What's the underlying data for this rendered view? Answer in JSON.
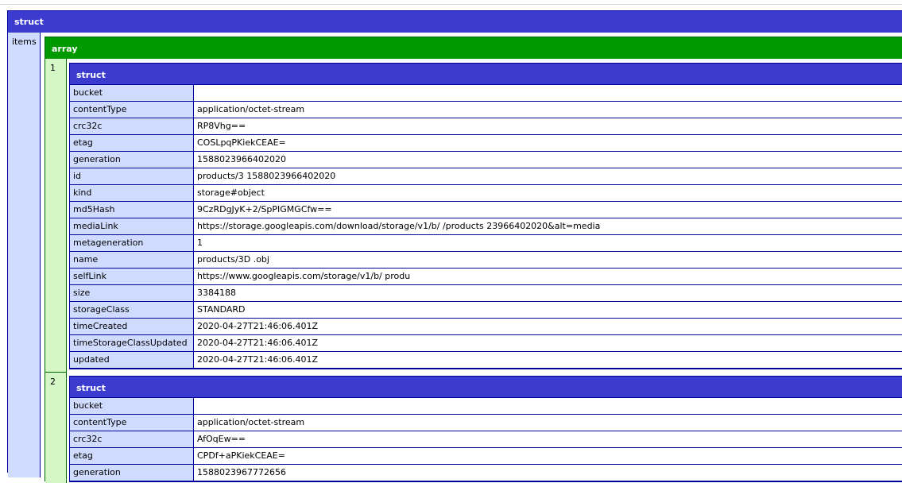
{
  "outer": {
    "title": "struct",
    "items_label": "items"
  },
  "array": {
    "title": "array"
  },
  "records": [
    {
      "index": "1",
      "title": "struct",
      "fields": [
        {
          "key": "bucket",
          "value": ""
        },
        {
          "key": "contentType",
          "value": "application/octet-stream"
        },
        {
          "key": "crc32c",
          "value": "RP8Vhg=="
        },
        {
          "key": "etag",
          "value": "COSLpqPKiekCEAE="
        },
        {
          "key": "generation",
          "value": "1588023966402020"
        },
        {
          "key": "id",
          "value": "products/3                                  1588023966402020"
        },
        {
          "key": "kind",
          "value": "storage#object"
        },
        {
          "key": "md5Hash",
          "value": "9CzRDgJyK+2/SpPIGMGCfw=="
        },
        {
          "key": "mediaLink",
          "value": "https://storage.googleapis.com/download/storage/v1/b/                  /products                                                           23966402020&alt=media"
        },
        {
          "key": "metageneration",
          "value": "1"
        },
        {
          "key": "name",
          "value": "products/3D                 .obj"
        },
        {
          "key": "selfLink",
          "value": "https://www.googleapis.com/storage/v1/b/                  produ"
        },
        {
          "key": "size",
          "value": "3384188"
        },
        {
          "key": "storageClass",
          "value": "STANDARD"
        },
        {
          "key": "timeCreated",
          "value": "2020-04-27T21:46:06.401Z"
        },
        {
          "key": "timeStorageClassUpdated",
          "value": "2020-04-27T21:46:06.401Z"
        },
        {
          "key": "updated",
          "value": "2020-04-27T21:46:06.401Z"
        }
      ]
    },
    {
      "index": "2",
      "title": "struct",
      "fields": [
        {
          "key": "bucket",
          "value": ""
        },
        {
          "key": "contentType",
          "value": "application/octet-stream"
        },
        {
          "key": "crc32c",
          "value": "AfOqEw=="
        },
        {
          "key": "etag",
          "value": "CPDf+aPKiekCEAE="
        },
        {
          "key": "generation",
          "value": "1588023967772656"
        }
      ]
    }
  ]
}
